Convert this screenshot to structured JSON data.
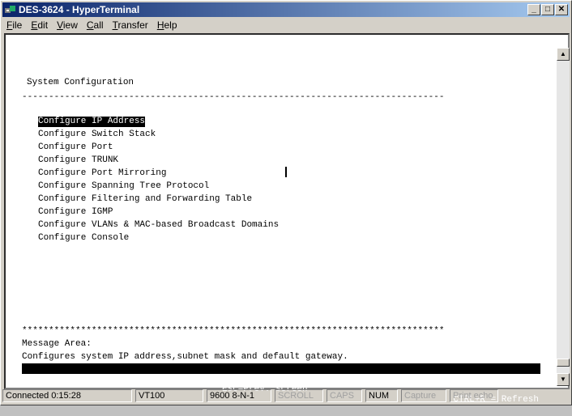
{
  "window": {
    "title": "DES-3624 - HyperTerminal"
  },
  "menu": [
    "File",
    "Edit",
    "View",
    "Call",
    "Transfer",
    "Help"
  ],
  "terminal": {
    "heading": "System Configuration",
    "dashes": "-------------------------------------------------------------------------------",
    "items": [
      "Configure IP Address",
      "Configure Switch Stack",
      "Configure Port",
      "Configure TRUNK",
      "Configure Port Mirroring",
      "Configure Spanning Tree Protocol",
      "Configure Filtering and Forwarding Table",
      "Configure IGMP",
      "Configure VLANs & MAC-based Broadcast Domains",
      "Configure Console"
    ],
    "selected_index": 0,
    "stars": "*******************************************************************************",
    "message_label": "Message Area:",
    "message_text": "Configures system IP address,subnet mask and default gateway.",
    "footer_left": "CTRL+T=Root screen",
    "footer_mid": "Esc=Prev. screen",
    "footer_right": "CTRL+R = Refresh"
  },
  "status": {
    "connected": "Connected 0:15:28",
    "emulation": "VT100",
    "settings": "9600 8-N-1",
    "scroll": "SCROLL",
    "caps": "CAPS",
    "num": "NUM",
    "capture": "Capture",
    "print_echo": "Print echo"
  }
}
